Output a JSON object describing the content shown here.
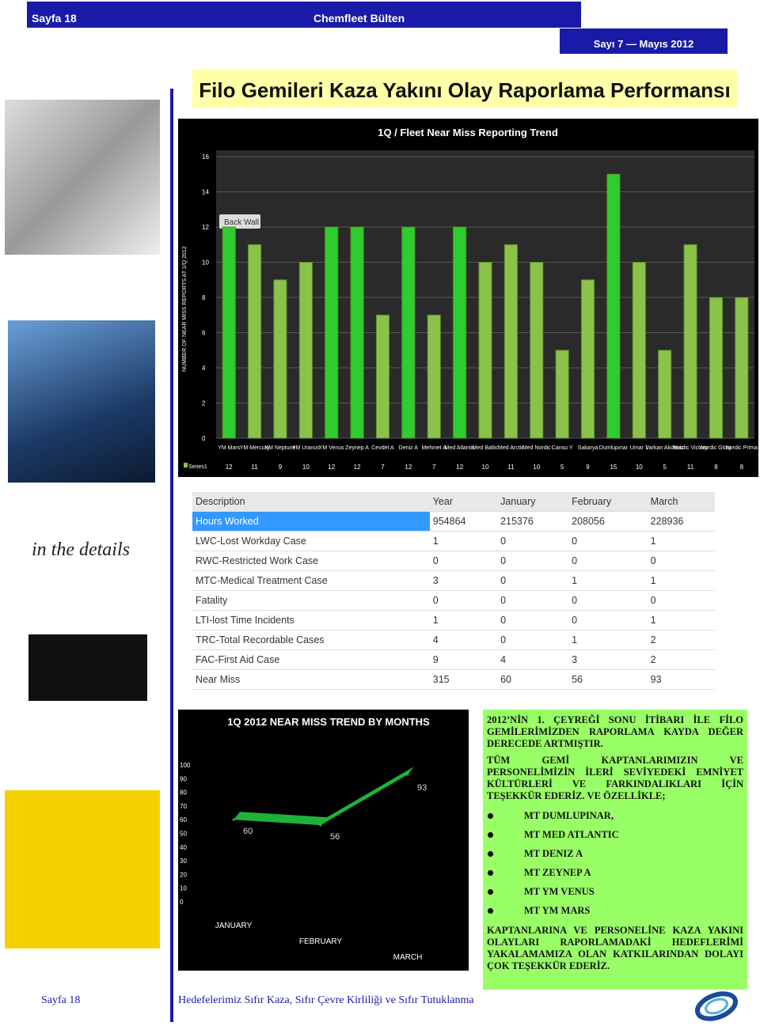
{
  "header": {
    "page": "Sayfa 18",
    "title": "Chemfleet Bülten",
    "issue": "Sayı 7 — Mayıs 2012"
  },
  "main_title": "Filo Gemileri Kaza Yakını Olay Raporlama Performansı",
  "side_images": {
    "details_caption": "in the details"
  },
  "chart_data": [
    {
      "type": "bar",
      "title": "1Q / Fleet Near Miss Reporting Trend",
      "ylabel": "NUMBER OF NEAR MISS REPORTS AT 1/Q 2012",
      "ylim": [
        0,
        16
      ],
      "yticks": [
        0,
        2,
        4,
        6,
        8,
        10,
        12,
        14,
        16
      ],
      "annotation": "Back Wall",
      "grid": true,
      "legend": "bottom-left",
      "categories": [
        "YM Mars",
        "YM Mercury",
        "YM Neptune",
        "YM Uranus",
        "YM Venus",
        "Zeynep A",
        "Cevdet A",
        "Deniz A",
        "Mehmet A",
        "Med Atlantic",
        "Med Baltic",
        "Med Arctic",
        "Med Nordic",
        "Cansu Y",
        "Sakarya",
        "Dumlupınar",
        "Umar 1",
        "Varkan Akdeniz",
        "Nordic Victory",
        "Nordic Glory",
        "Nordic Prima"
      ],
      "series": [
        {
          "name": "Series1",
          "values": [
            12,
            11,
            9,
            10,
            12,
            12,
            7,
            12,
            7,
            12,
            10,
            11,
            10,
            5,
            9,
            15,
            10,
            5,
            11,
            8,
            8
          ]
        }
      ],
      "color": "#8bc34a"
    },
    {
      "type": "line",
      "title": "1Q 2012 NEAR MISS TREND BY MONTHS",
      "ylim": [
        0,
        100
      ],
      "yticks": [
        0,
        10,
        20,
        30,
        40,
        50,
        60,
        70,
        80,
        90,
        100
      ],
      "categories": [
        "JANUARY",
        "FEBRUARY",
        "MARCH"
      ],
      "series": [
        {
          "values": [
            60,
            56,
            93
          ]
        }
      ],
      "color": "#1db33a"
    }
  ],
  "table": {
    "headers": [
      "Description",
      "Year",
      "January",
      "February",
      "March"
    ],
    "rows": [
      [
        "Hours Worked",
        "954864",
        "215376",
        "208056",
        "228936"
      ],
      [
        "LWC-Lost Workday Case",
        "1",
        "0",
        "0",
        "1"
      ],
      [
        "RWC-Restricted Work Case",
        "0",
        "0",
        "0",
        "0"
      ],
      [
        "MTC-Medical Treatment Case",
        "3",
        "0",
        "1",
        "1"
      ],
      [
        "Fatality",
        "0",
        "0",
        "0",
        "0"
      ],
      [
        "LTI-lost Time Incidents",
        "1",
        "0",
        "0",
        "1"
      ],
      [
        "TRC-Total Recordable Cases",
        "4",
        "0",
        "1",
        "2"
      ],
      [
        "FAC-First Aid Case",
        "9",
        "4",
        "3",
        "2"
      ],
      [
        "Near Miss",
        "315",
        "60",
        "56",
        "93"
      ]
    ]
  },
  "notice": {
    "p1": "2012’NİN 1. ÇEYREĞİ SONU İTİBARI İLE FİLO GEMİLERİMİZDEN RAPORLAMA KAYDA DEĞER DERECEDE ARTMIŞTIR.",
    "p2": "TÜM GEMİ KAPTANLARIMIZIN VE PERSONELİMİZİN İLERİ SEVİYEDEKİ EMNİYET KÜLTÜRLERİ VE FARKINDALIKLARI İÇİN TEŞEKKÜR EDERİZ. VE ÖZELLİKLE;",
    "ships": [
      "MT DUMLUPINAR,",
      "MT MED ATLANTIC",
      "MT DENIZ A",
      "MT ZEYNEP A",
      "MT YM VENUS",
      "MT YM MARS"
    ],
    "p3": "KAPTANLARINA VE PERSONELİNE KAZA YAKINI OLAYLARI RAPORLAMADAKİ HEDEFLERİMİ YAKALAMAMIZA OLAN KATKILARINDAN DOLAYI ÇOK TEŞEKKÜR EDERİZ."
  },
  "footer": {
    "page": "Sayfa  18",
    "slogan": "Hedefelerimiz Sıfır Kaza, Sıfır Çevre Kirliliği ve Sıfır Tutuklanma"
  }
}
